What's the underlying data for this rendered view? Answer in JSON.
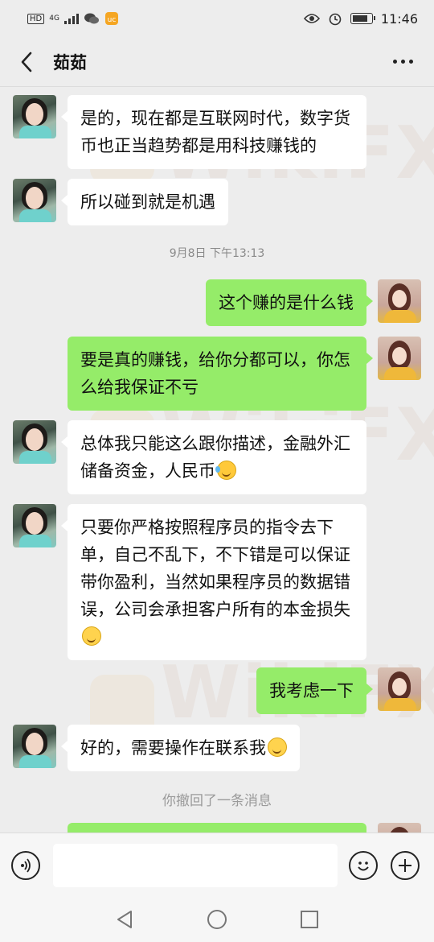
{
  "status_bar": {
    "left_badges": [
      "HD",
      "4G"
    ],
    "time": "11:46"
  },
  "header": {
    "contact_name": "茹茹"
  },
  "chat": {
    "messages": [
      {
        "side": "in",
        "text": "是的，现在都是互联网时代，数字货币也正当趋势都是用科技赚钱的"
      },
      {
        "side": "in",
        "text": "所以碰到就是机遇"
      },
      {
        "side": "out",
        "text": "这个赚的是什么钱"
      },
      {
        "side": "out",
        "text": "要是真的赚钱，给你分都可以，你怎么给我保证不亏"
      },
      {
        "side": "in",
        "text": "总体我只能这么跟你描述，金融外汇储备资金，人民币",
        "emoji": "laugh-cry-emoji"
      },
      {
        "side": "in",
        "text": "只要你严格按照程序员的指令去下单，自己不乱下，不下错是可以保证带你盈利，当然如果程序员的数据错误，公司会承担客户所有的本金损失",
        "emoji": "smile-emoji"
      },
      {
        "side": "out",
        "text": "我考虑一下"
      },
      {
        "side": "in",
        "text": "好的，需要操作在联系我",
        "emoji": "smile-emoji"
      }
    ],
    "timestamp": "9月8日 下午13:13",
    "system_note": "你撤回了一条消息"
  },
  "watermark": {
    "text": "WikiFX"
  },
  "input_bar": {
    "value": ""
  },
  "colors": {
    "background": "#ededed",
    "incoming_bubble": "#ffffff",
    "outgoing_bubble": "#95ec69"
  }
}
